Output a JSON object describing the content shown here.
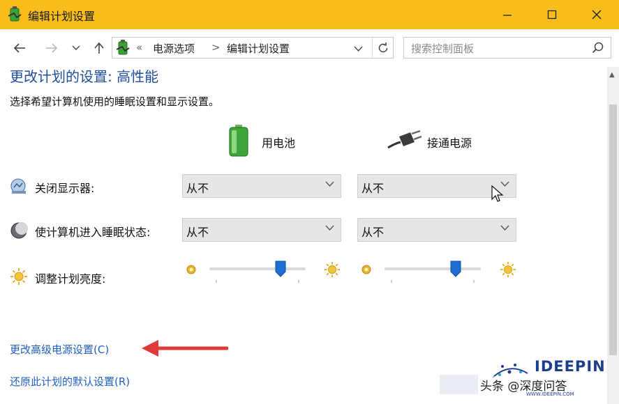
{
  "window": {
    "title": "编辑计划设置"
  },
  "nav": {
    "breadcrumb": [
      "电源选项",
      "编辑计划设置"
    ],
    "breadcrumb_overflow": "«",
    "breadcrumb_separator": ">",
    "search_placeholder": "搜索控制面板"
  },
  "main": {
    "heading": "更改计划的设置: 高性能",
    "description": "选择希望计算机使用的睡眠设置和显示设置。",
    "columns": {
      "battery": "用电池",
      "plugged_in": "接通电源"
    },
    "rows": [
      {
        "label": "关闭显示器:",
        "battery_value": "从不",
        "plugged_value": "从不"
      },
      {
        "label": "使计算机进入睡眠状态:",
        "battery_value": "从不",
        "plugged_value": "从不"
      }
    ],
    "brightness": {
      "label": "调整计划亮度:",
      "battery_level": 0.77,
      "plugged_level": 0.77
    },
    "links": {
      "advanced": "更改高级电源设置(C)",
      "restore": "还原此计划的默认设置(R)"
    }
  },
  "watermark": {
    "logo": "IDEEPIN",
    "caption": "头条 @深度问答",
    "sub": "WWW.IDEEPIN.COM"
  },
  "colors": {
    "titlebar": "#f6bd1b",
    "heading": "#1e4e9c",
    "link": "#1f5fc2",
    "arrow": "#e03a3a"
  }
}
